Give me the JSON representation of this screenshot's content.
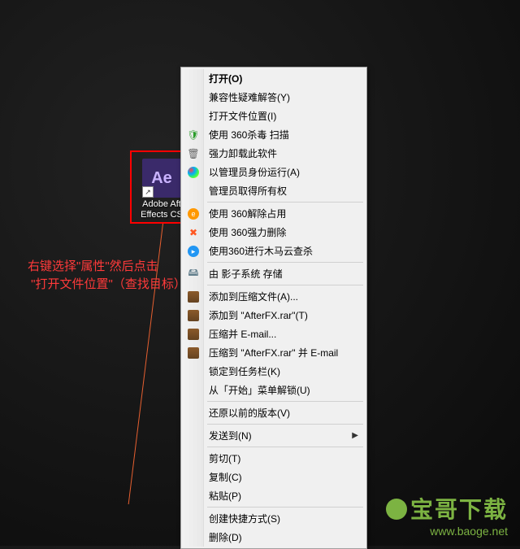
{
  "desktop_icon": {
    "app_short": "Ae",
    "label_line1": "Adobe Aft",
    "label_line2": "Effects CS"
  },
  "annotation": {
    "line1": "右键选择\"属性\"然后点击",
    "line2": " \"打开文件位置\"（查找目标）"
  },
  "menu": {
    "open": "打开(O)",
    "compat": "兼容性疑难解答(Y)",
    "open_location": "打开文件位置(I)",
    "scan_360": "使用 360杀毒 扫描",
    "force_uninstall": "强力卸载此软件",
    "run_as_admin": "以管理员身份运行(A)",
    "admin_ownership": "管理员取得所有权",
    "release_360": "使用 360解除占用",
    "force_delete_360": "使用 360强力删除",
    "trojan_360": "使用360进行木马云查杀",
    "storm_save": "由 影子系统 存储",
    "add_to_archive": "添加到压缩文件(A)...",
    "add_to_rar": "添加到 \"AfterFX.rar\"(T)",
    "compress_email": "压缩并 E-mail...",
    "compress_rar_email": "压缩到 \"AfterFX.rar\" 并 E-mail",
    "pin_taskbar": "锁定到任务栏(K)",
    "unpin_start": "从「开始」菜单解锁(U)",
    "restore_versions": "还原以前的版本(V)",
    "send_to": "发送到(N)",
    "cut": "剪切(T)",
    "copy": "复制(C)",
    "paste": "粘贴(P)",
    "create_shortcut": "创建快捷方式(S)",
    "delete": "删除(D)"
  },
  "watermark": {
    "text": "宝哥下载",
    "url": "www.baoge.net"
  }
}
